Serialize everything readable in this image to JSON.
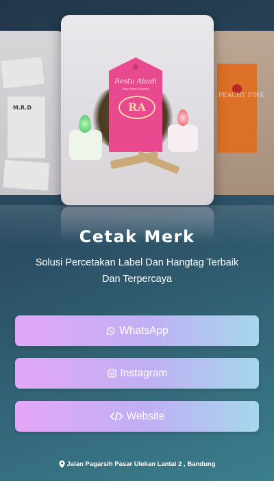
{
  "profile": {
    "name": "Cetak Merk",
    "tagline": "Solusi Percetakan Label Dan Hangtag Terbaik Dan Terpercaya"
  },
  "gallery": {
    "main_tag_brand": "Restu Abadi",
    "main_tag_sub": "Baby Shop & Fashion",
    "main_tag_logo": "RA",
    "right_tag_text": "PEACHY PINK",
    "left_tag_text": "M.R.D"
  },
  "links": [
    {
      "label": "WhatsApp",
      "icon": "whatsapp-icon"
    },
    {
      "label": "Instagram",
      "icon": "instagram-icon"
    },
    {
      "label": "Website",
      "icon": "code-icon"
    }
  ],
  "footer": {
    "address": "Jalan Pagarsih Pasar Ulekan Lantai 2 , Bandung",
    "icon": "map-marker-icon"
  },
  "colors": {
    "background_start": "#22364a",
    "background_end": "#3b7f8c",
    "button_gradient_start": "#e3a7f7",
    "button_gradient_end": "#a6d7ec",
    "text": "#ffffff"
  }
}
